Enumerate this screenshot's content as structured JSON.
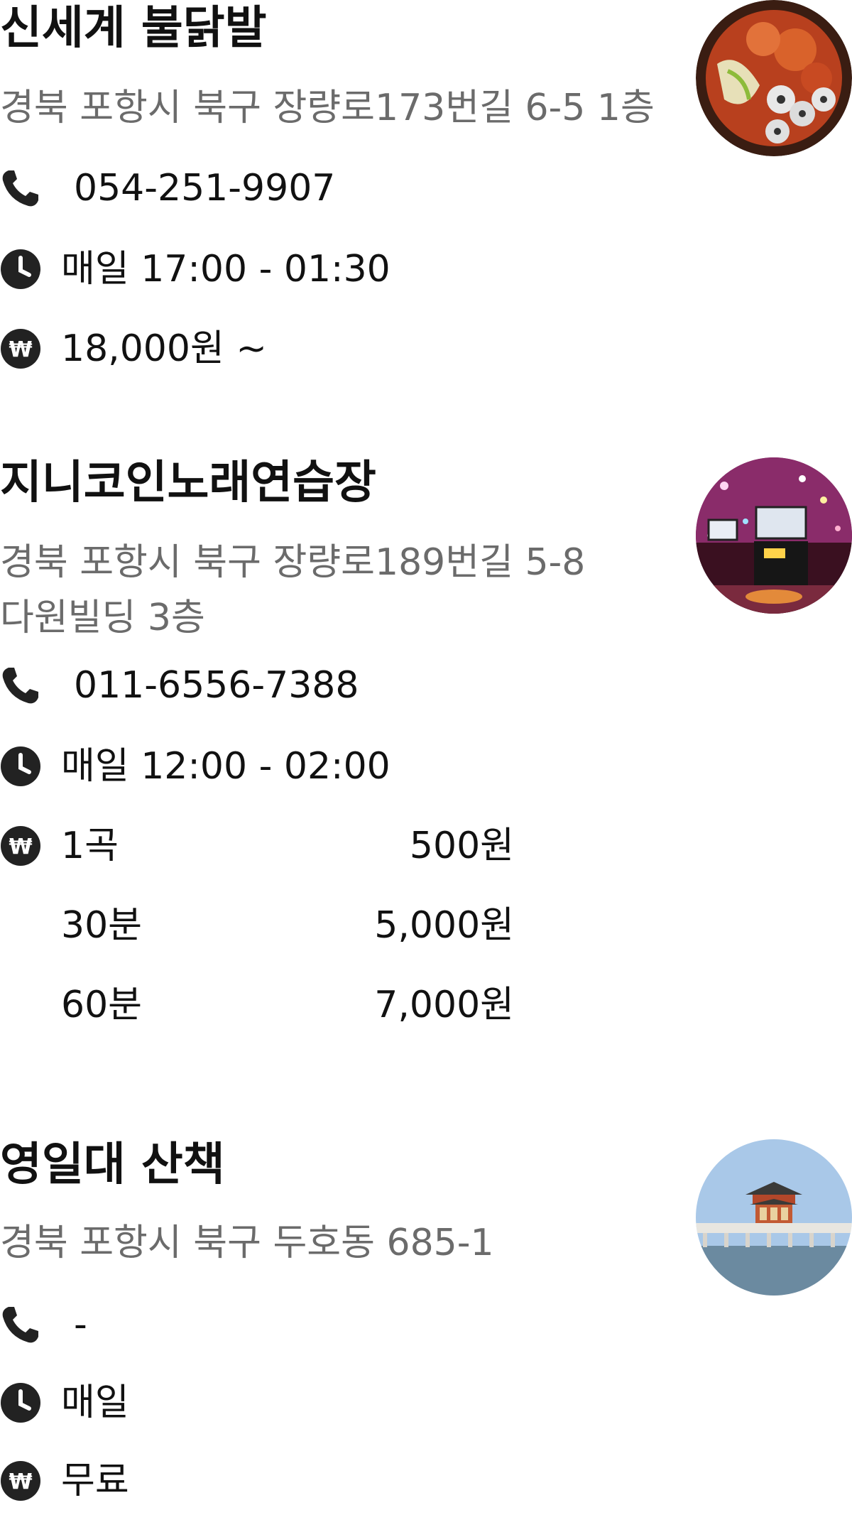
{
  "places": [
    {
      "name": "신세계 불닭발",
      "address_lines": [
        "경북 포항시 북구 장량로173번길 6-5 1층"
      ],
      "phone": "054-251-9907",
      "hours": "매일 17:00 - 01:30",
      "price": "18,000원 ~",
      "image_icon": "food-photo"
    },
    {
      "name": "지니코인노래연습장",
      "address_lines": [
        "경북 포항시 북구 장량로189번길 5-8",
        "다원빌딩 3층"
      ],
      "phone": "011-6556-7388",
      "hours": "매일 12:00 - 02:00",
      "prices": [
        {
          "label": "1곡",
          "value": "500원"
        },
        {
          "label": "30분",
          "value": "5,000원"
        },
        {
          "label": "60분",
          "value": "7,000원"
        }
      ],
      "image_icon": "karaoke-room-photo"
    },
    {
      "name": "영일대 산책",
      "address_lines": [
        "경북 포항시 북구 두호동 685-1"
      ],
      "phone": "-",
      "hours": "매일",
      "price": "무료",
      "image_icon": "pavilion-photo"
    }
  ],
  "icons": {
    "phone": "phone-icon",
    "clock": "clock-icon",
    "won": "won-icon"
  },
  "colors": {
    "title": "#111111",
    "address": "#6b6b6b",
    "icon": "#222222"
  }
}
